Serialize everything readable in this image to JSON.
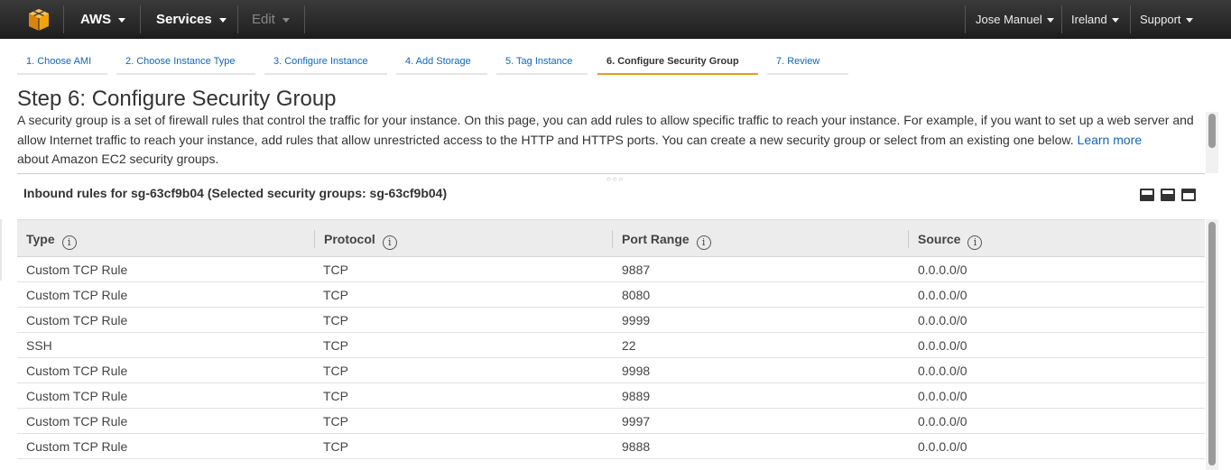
{
  "nav": {
    "aws": "AWS",
    "services": "Services",
    "edit": "Edit",
    "user": "Jose Manuel",
    "region": "Ireland",
    "support": "Support",
    "brand_color": "#f0a30a"
  },
  "wizard": {
    "tabs": [
      "1. Choose AMI",
      "2. Choose Instance Type",
      "3. Configure Instance",
      "4. Add Storage",
      "5. Tag Instance",
      "6. Configure Security Group",
      "7. Review"
    ],
    "active_index": 5
  },
  "page": {
    "title": "Step 6: Configure Security Group",
    "description_before_link": "A security group is a set of firewall rules that control the traffic for your instance. On this page, you can add rules to allow specific traffic to reach your instance. For example, if you want to set up a web server and allow Internet traffic to reach your instance, add rules that allow unrestricted access to the HTTP and HTTPS ports. You can create a new security group or select from an existing one below.",
    "link_text": "Learn more",
    "description_after_link": "about Amazon EC2 security groups."
  },
  "panel": {
    "title": "Inbound rules for sg-63cf9b04 (Selected security groups: sg-63cf9b04)"
  },
  "table": {
    "columns": [
      "Type",
      "Protocol",
      "Port Range",
      "Source"
    ],
    "rows": [
      [
        "Custom TCP Rule",
        "TCP",
        "9887",
        "0.0.0.0/0"
      ],
      [
        "Custom TCP Rule",
        "TCP",
        "8080",
        "0.0.0.0/0"
      ],
      [
        "Custom TCP Rule",
        "TCP",
        "9999",
        "0.0.0.0/0"
      ],
      [
        "SSH",
        "TCP",
        "22",
        "0.0.0.0/0"
      ],
      [
        "Custom TCP Rule",
        "TCP",
        "9998",
        "0.0.0.0/0"
      ],
      [
        "Custom TCP Rule",
        "TCP",
        "9889",
        "0.0.0.0/0"
      ],
      [
        "Custom TCP Rule",
        "TCP",
        "9997",
        "0.0.0.0/0"
      ],
      [
        "Custom TCP Rule",
        "TCP",
        "9888",
        "0.0.0.0/0"
      ]
    ]
  },
  "icons": {
    "logo": "aws-cube-icon",
    "info": "info-icon",
    "layout": [
      "layout-bottom-icon",
      "layout-half-icon",
      "layout-top-icon"
    ]
  }
}
